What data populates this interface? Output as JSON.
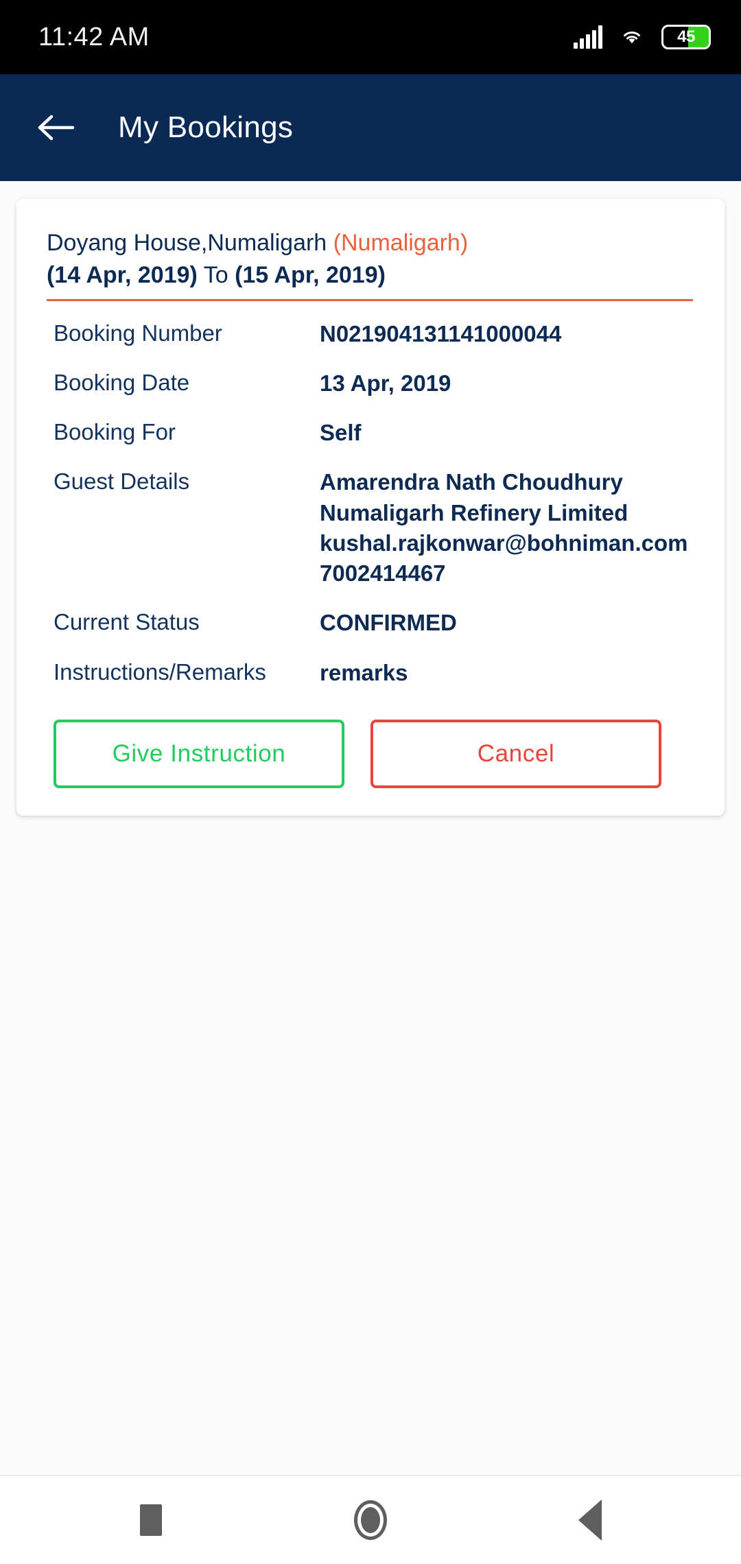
{
  "status_bar": {
    "time": "11:42 AM",
    "signal_icon": "signal-bars-icon",
    "wifi_icon": "wifi-icon",
    "battery_icon": "battery-icon",
    "battery_level": "45",
    "battery_percent": 45
  },
  "app_bar": {
    "back_icon": "back-arrow-icon",
    "title": "My Bookings",
    "background_color": "#0a2a55"
  },
  "booking": {
    "property": "Doyang House,Numaligarh",
    "location": "(Numaligarh)",
    "check_in": "(14 Apr, 2019)",
    "to_label": "To",
    "check_out": "(15 Apr, 2019)",
    "accent_color": "#e8603c",
    "rows": [
      {
        "label": "Booking Number",
        "value": "N021904131141000044"
      },
      {
        "label": "Booking Date",
        "value": "13 Apr, 2019"
      },
      {
        "label": "Booking For",
        "value": "Self"
      },
      {
        "label": "Guest Details",
        "lines": [
          "Amarendra Nath Choudhury",
          "Numaligarh Refinery Limited",
          "kushal.rajkonwar@bohniman.com",
          "7002414467"
        ]
      },
      {
        "label": "Current Status",
        "value": "CONFIRMED"
      },
      {
        "label": "Instructions/Remarks",
        "value": "remarks"
      }
    ],
    "guest_details": {
      "name": "Amarendra Nath Choudhury",
      "organisation": "Numaligarh Refinery Limited",
      "email": "kushal.rajkonwar@bohniman.com",
      "phone": "7002414467"
    },
    "current_status": "CONFIRMED",
    "remarks": "remarks"
  },
  "actions": {
    "give_instruction_label": "Give Instruction",
    "give_instruction_color": "#21cc5c",
    "cancel_label": "Cancel",
    "cancel_color": "#e8453c"
  },
  "nav_bar": {
    "recents_icon": "square-recents-icon",
    "home_icon": "circle-home-icon",
    "back_icon": "triangle-back-icon"
  }
}
